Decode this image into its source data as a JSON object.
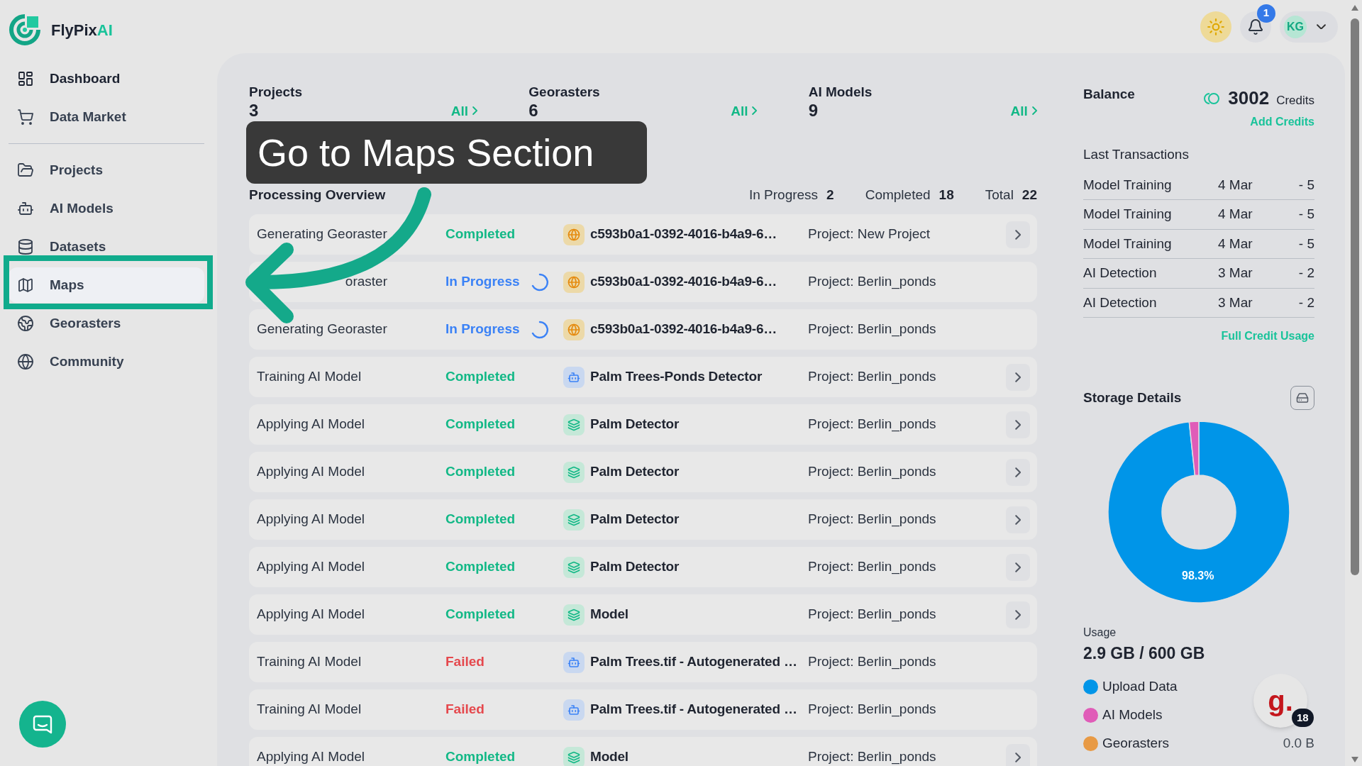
{
  "brand": {
    "name": "FlyPix",
    "accent": "AI"
  },
  "sidebar": {
    "items": [
      {
        "label": "Dashboard",
        "kind": "dashboard",
        "selected": false
      },
      {
        "label": "Data Market",
        "kind": "cart",
        "selected": false
      },
      {
        "label": "Projects",
        "kind": "folder",
        "selected": false,
        "divider_before": true
      },
      {
        "label": "AI Models",
        "kind": "bot",
        "selected": false
      },
      {
        "label": "Datasets",
        "kind": "database",
        "selected": false
      },
      {
        "label": "Maps",
        "kind": "map",
        "selected": true
      },
      {
        "label": "Georasters",
        "kind": "earth",
        "selected": false
      },
      {
        "label": "Community",
        "kind": "globe",
        "selected": false
      }
    ]
  },
  "header": {
    "notifications": "1",
    "user_initials": "KG"
  },
  "stats": [
    {
      "label": "Projects",
      "value": "3",
      "link": "All"
    },
    {
      "label": "Georasters",
      "value": "6",
      "link": "All"
    },
    {
      "label": "AI Models",
      "value": "9",
      "link": "All"
    }
  ],
  "processing": {
    "title": "Processing Overview",
    "counts": [
      {
        "label": "In Progress",
        "value": "2"
      },
      {
        "label": "Completed",
        "value": "18"
      },
      {
        "label": "Total",
        "value": "22"
      }
    ],
    "rows": [
      {
        "task": "Generating Georaster",
        "covered": false,
        "status": {
          "text": "Completed",
          "kind": "completed"
        },
        "item": {
          "name": "c593b0a1-0392-4016-b4a9-6…",
          "kind": "georaster"
        },
        "project": "Project: New Project",
        "open": true
      },
      {
        "task": "oraster",
        "covered": true,
        "status": {
          "text": "In Progress",
          "kind": "in_progress"
        },
        "item": {
          "name": "c593b0a1-0392-4016-b4a9-6…",
          "kind": "georaster"
        },
        "project": "Project: Berlin_ponds",
        "open": false
      },
      {
        "task": "Generating Georaster",
        "covered": false,
        "status": {
          "text": "In Progress",
          "kind": "in_progress"
        },
        "item": {
          "name": "c593b0a1-0392-4016-b4a9-6…",
          "kind": "georaster"
        },
        "project": "Project: Berlin_ponds",
        "open": false
      },
      {
        "task": "Training AI Model",
        "covered": false,
        "status": {
          "text": "Completed",
          "kind": "completed"
        },
        "item": {
          "name": "Palm Trees-Ponds Detector",
          "kind": "model"
        },
        "project": "Project: Berlin_ponds",
        "open": true
      },
      {
        "task": "Applying AI Model",
        "covered": false,
        "status": {
          "text": "Completed",
          "kind": "completed"
        },
        "item": {
          "name": "Palm Detector",
          "kind": "detector"
        },
        "project": "Project: Berlin_ponds",
        "open": true
      },
      {
        "task": "Applying AI Model",
        "covered": false,
        "status": {
          "text": "Completed",
          "kind": "completed"
        },
        "item": {
          "name": "Palm Detector",
          "kind": "detector"
        },
        "project": "Project: Berlin_ponds",
        "open": true
      },
      {
        "task": "Applying AI Model",
        "covered": false,
        "status": {
          "text": "Completed",
          "kind": "completed"
        },
        "item": {
          "name": "Palm Detector",
          "kind": "detector"
        },
        "project": "Project: Berlin_ponds",
        "open": true
      },
      {
        "task": "Applying AI Model",
        "covered": false,
        "status": {
          "text": "Completed",
          "kind": "completed"
        },
        "item": {
          "name": "Palm Detector",
          "kind": "detector"
        },
        "project": "Project: Berlin_ponds",
        "open": true
      },
      {
        "task": "Applying AI Model",
        "covered": false,
        "status": {
          "text": "Completed",
          "kind": "completed"
        },
        "item": {
          "name": "Model",
          "kind": "detector"
        },
        "project": "Project: Berlin_ponds",
        "open": true
      },
      {
        "task": "Training AI Model",
        "covered": false,
        "status": {
          "text": "Failed",
          "kind": "failed"
        },
        "item": {
          "name": "Palm Trees.tif - Autogenerated …",
          "kind": "model"
        },
        "project": "Project: Berlin_ponds",
        "open": false
      },
      {
        "task": "Training AI Model",
        "covered": false,
        "status": {
          "text": "Failed",
          "kind": "failed"
        },
        "item": {
          "name": "Palm Trees.tif - Autogenerated …",
          "kind": "model"
        },
        "project": "Project: Berlin_ponds",
        "open": false
      },
      {
        "task": "Applying AI Model",
        "covered": false,
        "status": {
          "text": "Completed",
          "kind": "completed"
        },
        "item": {
          "name": "Model",
          "kind": "detector"
        },
        "project": "Project: Berlin_ponds",
        "open": true
      }
    ]
  },
  "balance": {
    "title": "Balance",
    "amount": "3002",
    "unit": "Credits",
    "add_link": "Add Credits",
    "transactions_title": "Last Transactions",
    "transactions": [
      {
        "name": "Model Training",
        "date": "4 Mar",
        "amount": "- 5"
      },
      {
        "name": "Model Training",
        "date": "4 Mar",
        "amount": "- 5"
      },
      {
        "name": "Model Training",
        "date": "4 Mar",
        "amount": "- 5"
      },
      {
        "name": "AI Detection",
        "date": "3 Mar",
        "amount": "- 2"
      },
      {
        "name": "AI Detection",
        "date": "3 Mar",
        "amount": "- 2"
      }
    ],
    "full_link": "Full Credit Usage"
  },
  "storage": {
    "title": "Storage Details",
    "slice_label": "98.3%",
    "chart_data": {
      "type": "donut",
      "categories": [
        "Upload Data",
        "AI Models",
        "Georasters"
      ],
      "values": [
        98.3,
        1.7,
        0.0
      ]
    },
    "usage_label": "Usage",
    "usage": "2.9 GB / 600 GB",
    "legend": [
      {
        "color": "#0095e8"
      },
      {
        "color": "#e05cb8"
      },
      {
        "color": "#e89a45",
        "value": "0.0 B"
      }
    ]
  },
  "tutorial": {
    "callout": "Go to Maps Section"
  },
  "grammar_widget": {
    "letter": "g.",
    "count": "18"
  }
}
